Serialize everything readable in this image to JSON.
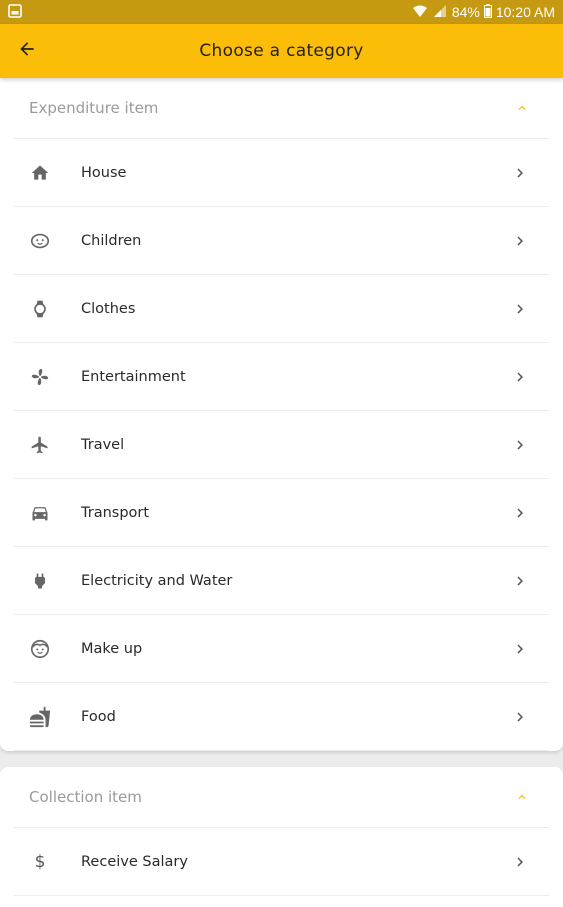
{
  "status_bar": {
    "battery": "84%",
    "time": "10:20 AM"
  },
  "app_bar": {
    "title": "Choose a category",
    "back_icon": "arrow-left-icon"
  },
  "colors": {
    "accent": "#fbbd08",
    "status_bar": "#c59a12",
    "text": "#2a2a2a",
    "muted": "#9a9a9a"
  },
  "sections": [
    {
      "title": "Expenditure item",
      "expanded": true,
      "items": [
        {
          "label": "House",
          "icon": "home-icon"
        },
        {
          "label": "Children",
          "icon": "baby-face-icon"
        },
        {
          "label": "Clothes",
          "icon": "watch-icon"
        },
        {
          "label": "Entertainment",
          "icon": "pinwheel-icon"
        },
        {
          "label": "Travel",
          "icon": "airplane-icon"
        },
        {
          "label": "Transport",
          "icon": "car-icon"
        },
        {
          "label": "Electricity and Water",
          "icon": "power-plug-icon"
        },
        {
          "label": "Make up",
          "icon": "face-icon"
        },
        {
          "label": "Food",
          "icon": "fastfood-icon"
        }
      ]
    },
    {
      "title": "Collection item",
      "expanded": true,
      "items": [
        {
          "label": "Receive Salary",
          "icon": "dollar-icon"
        }
      ]
    }
  ]
}
